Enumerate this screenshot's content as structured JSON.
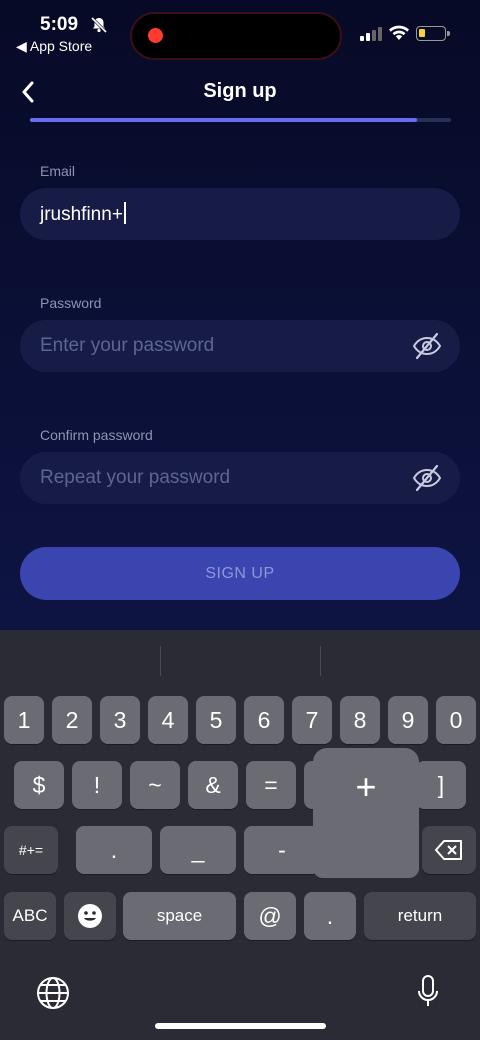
{
  "status_bar": {
    "time": "5:09",
    "back_app": "◀ App Store"
  },
  "header": {
    "title": "Sign up",
    "progress": 0.92
  },
  "form": {
    "email": {
      "label": "Email",
      "value": "jrushfinn+"
    },
    "password": {
      "label": "Password",
      "placeholder": "Enter your password"
    },
    "confirm": {
      "label": "Confirm password",
      "placeholder": "Repeat your password"
    },
    "submit_label": "SIGN UP"
  },
  "keyboard": {
    "row1": [
      "1",
      "2",
      "3",
      "4",
      "5",
      "6",
      "7",
      "8",
      "9",
      "0"
    ],
    "row2": [
      "$",
      "!",
      "~",
      "&",
      "=",
      "]"
    ],
    "row3": [
      ".",
      "_",
      "-"
    ],
    "symbols_key": "#+=",
    "abc_key": "ABC",
    "space_key": "space",
    "at_key": "@",
    "dot_key": ".",
    "return_key": "return",
    "popup_key": "+"
  },
  "colors": {
    "accent": "#6a6cf0",
    "button": "#3b45b0",
    "field_bg": "#171c46",
    "background": "#0a0e2e"
  }
}
